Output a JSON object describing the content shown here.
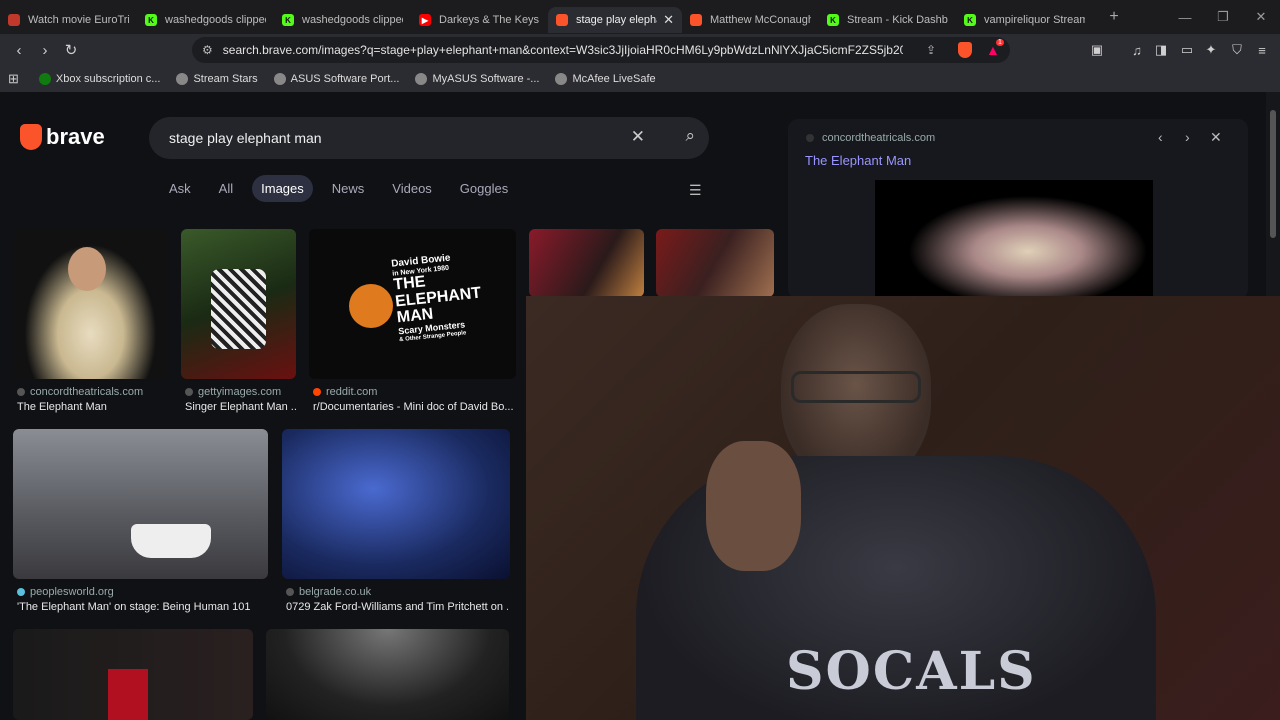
{
  "tabs": [
    {
      "title": "Watch movie EuroTrip",
      "favicon_color": "#c0392b",
      "favicon_icon": "video-icon"
    },
    {
      "title": "washedgoods clipped",
      "favicon_color": "#53fc18",
      "favicon_icon": "kick-icon"
    },
    {
      "title": "washedgoods clipped",
      "favicon_color": "#53fc18",
      "favicon_icon": "kick-icon"
    },
    {
      "title": "Darkeys & The Keys",
      "favicon_color": "#ff0000",
      "favicon_icon": "youtube-icon"
    },
    {
      "title": "stage play elephant man",
      "favicon_color": "#fb542b",
      "favicon_icon": "brave-icon",
      "active": true
    },
    {
      "title": "Matthew McConaughey",
      "favicon_color": "#fb542b",
      "favicon_icon": "brave-icon"
    },
    {
      "title": "Stream - Kick Dashboard",
      "favicon_color": "#53fc18",
      "favicon_icon": "kick-icon"
    },
    {
      "title": "vampireliquor Stream",
      "favicon_color": "#53fc18",
      "favicon_icon": "kick-icon"
    }
  ],
  "toolbar": {
    "url": "search.brave.com/images?q=stage+play+elephant+man&context=W3sic3JjIjoiaHR0cHM6Ly9pbWdzLnNlYXJjaC5icmF2ZS5jb20vZ3pPTV9...",
    "rewards_badge": "1"
  },
  "bookmarks": [
    {
      "label": "Xbox subscription c...",
      "color": "#107c10"
    },
    {
      "label": "Stream Stars",
      "color": "#888888"
    },
    {
      "label": "ASUS Software Port...",
      "color": "#888888"
    },
    {
      "label": "MyASUS Software -...",
      "color": "#888888"
    },
    {
      "label": "McAfee LiveSafe",
      "color": "#888888"
    }
  ],
  "search": {
    "brand": "brave",
    "query": "stage play elephant man",
    "tabs": [
      "Ask",
      "All",
      "Images",
      "News",
      "Videos",
      "Goggles"
    ],
    "active_tab": "Images"
  },
  "results": [
    {
      "source": "concordtheatricals.com",
      "caption": "The Elephant Man"
    },
    {
      "source": "gettyimages.com",
      "caption": "Singer Elephant Man ..."
    },
    {
      "source": "reddit.com",
      "caption": "r/Documentaries - Mini doc of David Bo..."
    },
    {
      "source": "peoplesworld.org",
      "caption": "'The Elephant Man' on stage: Being Human 101"
    },
    {
      "source": "belgrade.co.uk",
      "caption": "0729 Zak Ford-Williams and Tim Pritchett on ..."
    }
  ],
  "bowie_image_text": {
    "line1": "David Bowie",
    "line2": "in New York 1980",
    "line3": "THE",
    "line4": "ELEPHANT",
    "line5": "MAN",
    "line6": "Scary Monsters",
    "line7": "& Other Strange People"
  },
  "panel": {
    "source": "concordtheatricals.com",
    "title": "The Elephant Man"
  },
  "webcam": {
    "shirt_text": "SOCALS"
  }
}
